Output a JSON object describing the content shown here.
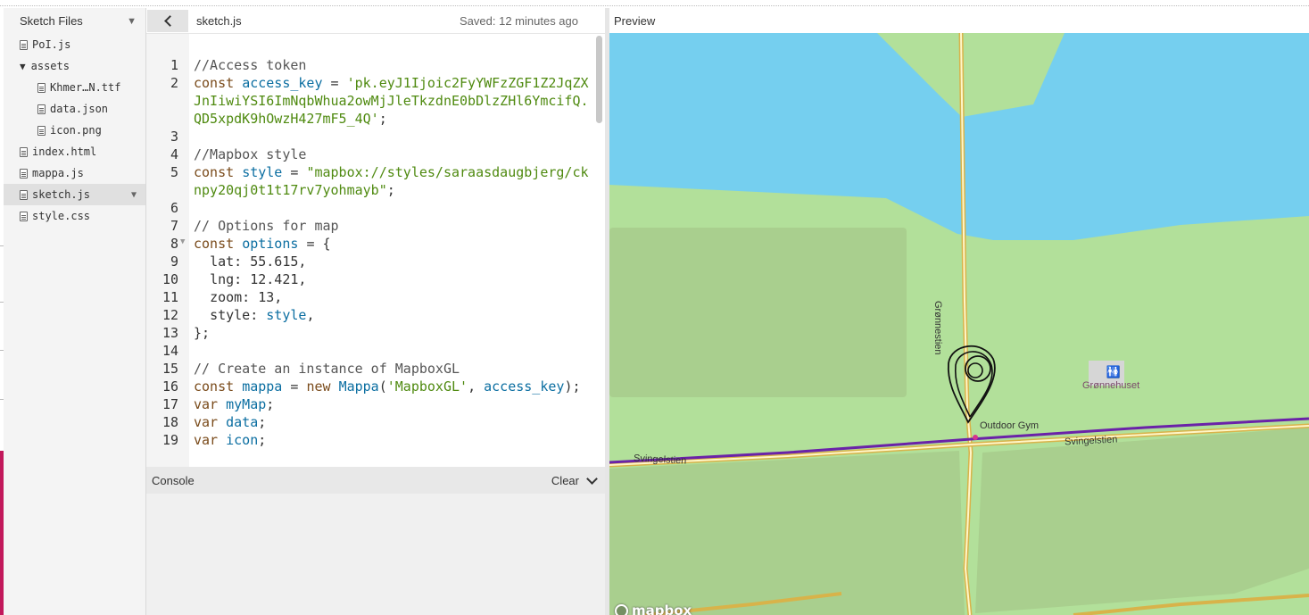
{
  "sidebar": {
    "title": "Sketch Files",
    "items": [
      {
        "label": "PoI.js"
      },
      {
        "label": "assets"
      },
      {
        "label": "Khmer…N.ttf"
      },
      {
        "label": "data.json"
      },
      {
        "label": "icon.png"
      },
      {
        "label": "index.html"
      },
      {
        "label": "mappa.js"
      },
      {
        "label": "sketch.js"
      },
      {
        "label": "style.css"
      }
    ]
  },
  "editor": {
    "tab_name": "sketch.js",
    "saved_status": "Saved: 12 minutes ago",
    "lines": [
      {
        "num": "1",
        "comment": "//Access token"
      },
      {
        "num": "2",
        "kw": "const",
        "var": "access_key",
        "op": "=",
        "str": "'pk.eyJ1Ijoic2FyYWFzZGF1Z2JqZXJnIiwiYSI6ImNqbWhua2owMjJleTkzdnE0bDlzZHl6YmcifQ.QD5xpdK9hOwzH427mF5_4Q'",
        "end": ";"
      },
      {
        "num": "3"
      },
      {
        "num": "4",
        "comment": "//Mapbox style"
      },
      {
        "num": "5",
        "kw": "const",
        "var": "style",
        "op": "=",
        "str": "\"mapbox://styles/saraasdaugbjerg/cknpy20qj0t1t17rv7yohmayb\"",
        "end": ";"
      },
      {
        "num": "6"
      },
      {
        "num": "7",
        "comment": "// Options for map"
      },
      {
        "num": "8",
        "kw": "const",
        "var": "options",
        "op": "= {"
      },
      {
        "num": "9",
        "text": "  lat: 55.615,"
      },
      {
        "num": "10",
        "text": "  lng: 12.421,"
      },
      {
        "num": "11",
        "text": "  zoom: 13,"
      },
      {
        "num": "12",
        "prefix": "  style: ",
        "var": "style",
        "end": ","
      },
      {
        "num": "13",
        "text": "};"
      },
      {
        "num": "14"
      },
      {
        "num": "15",
        "comment": "// Create an instance of MapboxGL"
      },
      {
        "num": "16",
        "kw": "const",
        "var": "mappa",
        "op": "=",
        "kw2": "new",
        "var2": "Mappa",
        "p1": "(",
        "str": "'MapboxGL'",
        "p2": ", ",
        "var3": "access_key",
        "end": ");"
      },
      {
        "num": "17",
        "kw": "var",
        "var": "myMap",
        "end": ";"
      },
      {
        "num": "18",
        "kw": "var",
        "var": "data",
        "end": ";"
      },
      {
        "num": "19",
        "kw": "var",
        "var": "icon",
        "end": ";"
      }
    ]
  },
  "console": {
    "title": "Console",
    "clear_label": "Clear"
  },
  "preview": {
    "title": "Preview",
    "labels": {
      "road_vertical": "Grønnestien",
      "outdoor_gym": "Outdoor Gym",
      "road_svingel_right": "Svingelstien",
      "road_svingel_left": "Svingelstien",
      "building": "Grønnehuset",
      "logo": "mapbox"
    },
    "colors": {
      "water": "#75cfef",
      "park": "#b2e09a",
      "dark_patch": "#a9cf8e",
      "road_casing": "#d8b34a",
      "road_fill": "#fff6c8",
      "bike_route": "#6a22a8"
    }
  }
}
